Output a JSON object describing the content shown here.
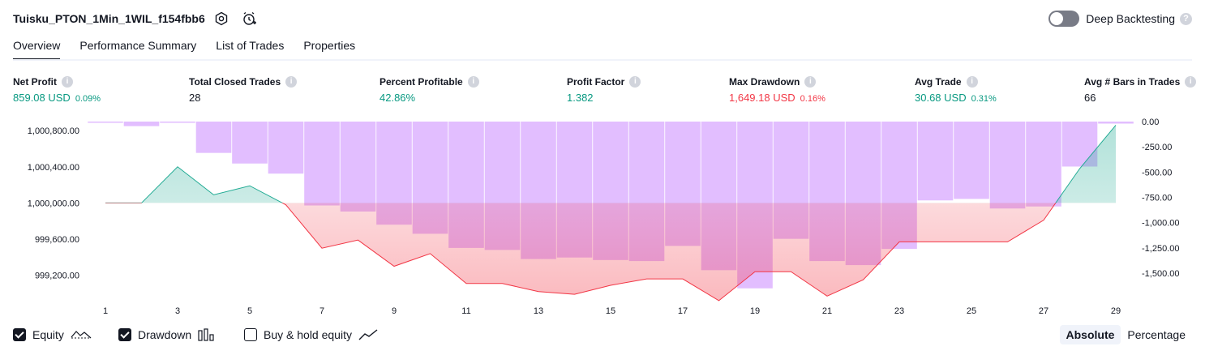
{
  "header": {
    "title": "Tuisku_PTON_1Min_1WIL_f154fbb6",
    "deep_backtesting_label": "Deep Backtesting",
    "deep_backtesting_on": false
  },
  "tabs": [
    {
      "label": "Overview",
      "active": true
    },
    {
      "label": "Performance Summary",
      "active": false
    },
    {
      "label": "List of Trades",
      "active": false
    },
    {
      "label": "Properties",
      "active": false
    }
  ],
  "metrics": [
    {
      "label": "Net Profit",
      "value": "859.08 USD",
      "pct": "0.09%"
    },
    {
      "label": "Total Closed Trades",
      "value": "28"
    },
    {
      "label": "Percent Profitable",
      "value": "42.86%"
    },
    {
      "label": "Profit Factor",
      "value": "1.382"
    },
    {
      "label": "Max Drawdown",
      "value": "1,649.18 USD",
      "pct": "0.16%"
    },
    {
      "label": "Avg Trade",
      "value": "30.68 USD",
      "pct": "0.31%"
    },
    {
      "label": "Avg # Bars in Trades",
      "value": "66"
    }
  ],
  "colors": {
    "equity_line": "#22ab94",
    "drawdown_line": "#f23645",
    "drawdown_bar": "#ce93ff",
    "positive": "#089981",
    "negative": "#f23645"
  },
  "chart_data": {
    "type": "line",
    "left_axis": {
      "ylim": [
        999000,
        1000900
      ],
      "ticks": [
        "1,000,800.00",
        "1,000,400.00",
        "1,000,000.00",
        "999,600.00",
        "999,200.00"
      ],
      "tick_values": [
        1000800,
        1000400,
        1000000,
        999600,
        999200
      ]
    },
    "right_axis": {
      "ylim": [
        -1700,
        0
      ],
      "ticks": [
        "0.00",
        "-250.00",
        "-500.00",
        "-750.00",
        "-1,000.00",
        "-1,250.00",
        "-1,500.00"
      ],
      "tick_values": [
        0,
        -250,
        -500,
        -750,
        -1000,
        -1250,
        -1500
      ]
    },
    "x_ticks": [
      "1",
      "3",
      "5",
      "7",
      "9",
      "11",
      "13",
      "15",
      "17",
      "19",
      "21",
      "23",
      "25",
      "27",
      "29"
    ],
    "x_tick_values": [
      1,
      3,
      5,
      7,
      9,
      11,
      13,
      15,
      17,
      19,
      21,
      23,
      25,
      27,
      29
    ],
    "series": [
      {
        "name": "Equity",
        "x": [
          1,
          2,
          3,
          4,
          5,
          6,
          7,
          8,
          9,
          10,
          11,
          12,
          13,
          14,
          15,
          16,
          17,
          18,
          19,
          20,
          21,
          22,
          23,
          24,
          25,
          26,
          27,
          28,
          29
        ],
        "values": [
          1000000,
          1000000,
          1000400,
          1000090,
          1000190,
          999980,
          999500,
          999590,
          999300,
          999440,
          999110,
          999110,
          999020,
          998990,
          999090,
          999160,
          999160,
          998920,
          999240,
          999240,
          998970,
          999150,
          999570,
          999570,
          999570,
          999570,
          999810,
          1000380,
          1000860
        ]
      },
      {
        "name": "Drawdown",
        "x": [
          1,
          2,
          3,
          4,
          5,
          6,
          7,
          8,
          9,
          10,
          11,
          12,
          13,
          14,
          15,
          16,
          17,
          18,
          19,
          20,
          21,
          22,
          23,
          24,
          25,
          26,
          27,
          28,
          29
        ],
        "values": [
          0,
          -45,
          0,
          -310,
          -415,
          -515,
          -830,
          -890,
          -1020,
          -1110,
          -1250,
          -1270,
          -1360,
          -1345,
          -1370,
          -1380,
          -1230,
          -1470,
          -1650,
          -1160,
          -1380,
          -1420,
          -1260,
          -780,
          -765,
          -860,
          -840,
          -445,
          -20
        ]
      }
    ]
  },
  "legend": [
    {
      "label": "Equity",
      "checked": true,
      "icon": "equity-line-icon"
    },
    {
      "label": "Drawdown",
      "checked": true,
      "icon": "drawdown-bars-icon"
    },
    {
      "label": "Buy & hold equity",
      "checked": false,
      "icon": "buy-hold-line-icon"
    }
  ],
  "mode": {
    "absolute_label": "Absolute",
    "percentage_label": "Percentage",
    "selected": "Absolute"
  }
}
